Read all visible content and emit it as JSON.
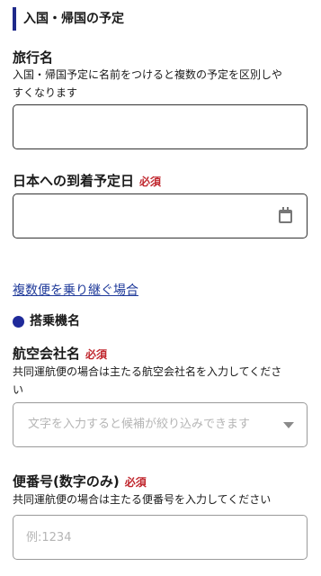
{
  "section": {
    "title": "入国・帰国の予定"
  },
  "trip_name": {
    "label": "旅行名",
    "help_line1": "入国・帰国予定に名前をつけると複数の予定を区別しや",
    "help_line2": "すくなります",
    "value": ""
  },
  "arrival_date": {
    "label": "日本への到着予定日",
    "required": "必須",
    "value": "",
    "icon": "calendar-icon"
  },
  "connecting_link": {
    "label": "複数便を乗り継ぐ場合"
  },
  "flight_section": {
    "title": "搭乗機名",
    "icon": "bullet-dot-icon"
  },
  "airline": {
    "label": "航空会社名",
    "required": "必須",
    "help_line1": "共同運航便の場合は主たる航空会社名を入力してくださ",
    "help_line2": "い",
    "placeholder": "文字を入力すると候補が絞り込みできます",
    "icon": "caret-down-icon"
  },
  "flight_number": {
    "label": "便番号(数字のみ)",
    "required": "必須",
    "help": "共同運航便の場合は主たる便番号を入力してください",
    "placeholder": "例:1234"
  }
}
